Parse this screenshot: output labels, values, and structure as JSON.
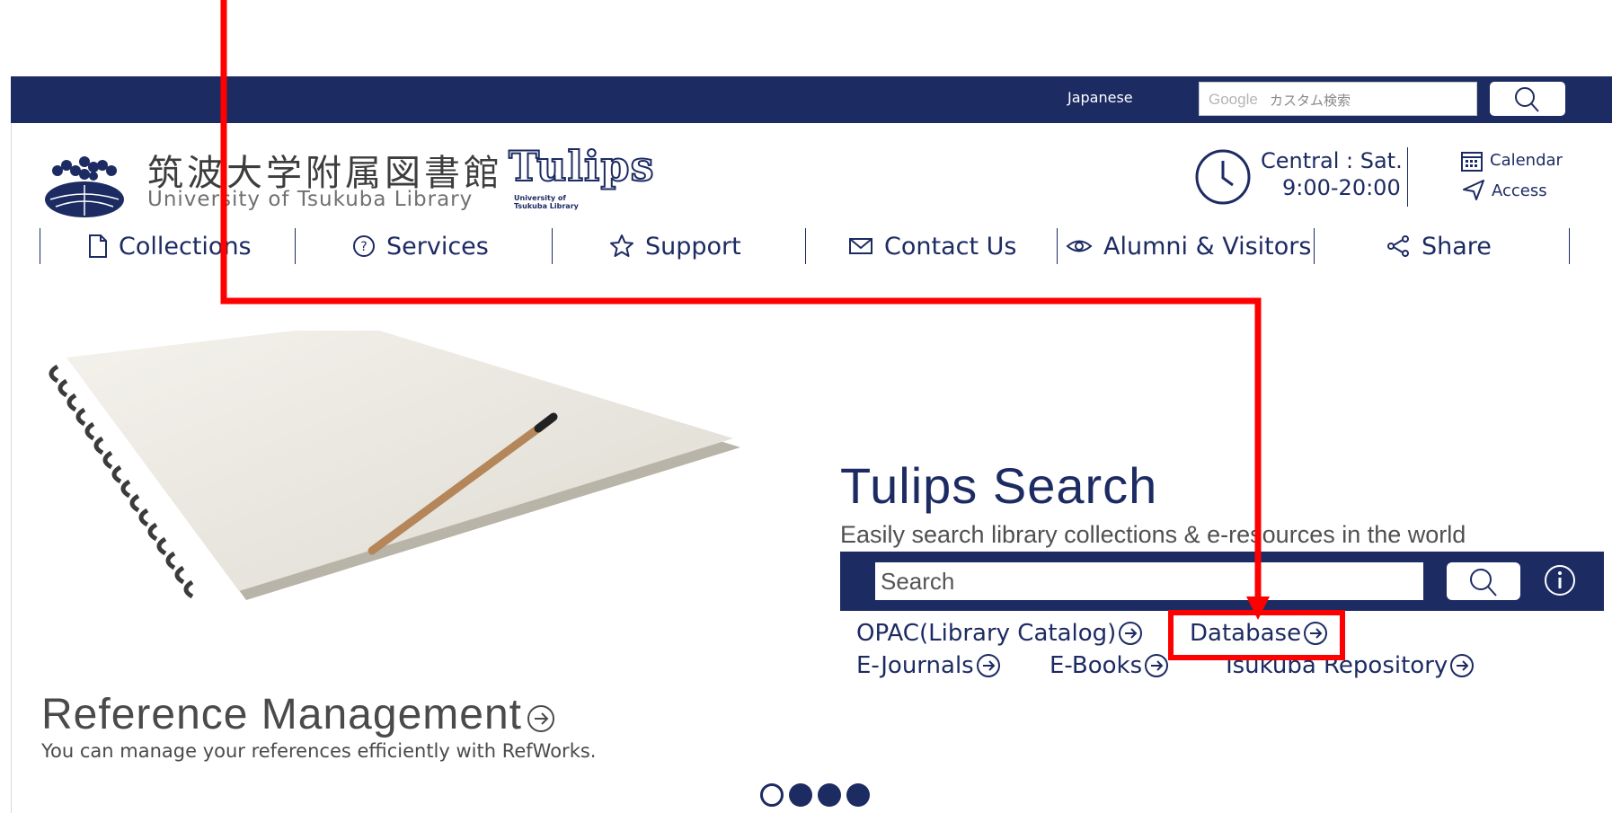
{
  "topbar": {
    "language_label": "Japanese",
    "google_label": "Google",
    "search_placeholder": "カスタム検索"
  },
  "header": {
    "logo_jp": "筑波大学附属図書館",
    "logo_en": "University of Tsukuba Library",
    "tulips_logo": "Tulips",
    "tulips_sub_1": "University of",
    "tulips_sub_2": "Tsukuba Library",
    "hours_line1": "Central : Sat.",
    "hours_line2": "9:00-20:00",
    "calendar_label": "Calendar",
    "access_label": "Access"
  },
  "nav": {
    "items": [
      {
        "label": "Collections",
        "icon": "document-icon"
      },
      {
        "label": "Services",
        "icon": "help-circle-icon"
      },
      {
        "label": "Support",
        "icon": "star-icon"
      },
      {
        "label": "Contact Us",
        "icon": "mail-icon"
      },
      {
        "label": "Alumni & Visitors",
        "icon": "eye-icon"
      },
      {
        "label": "Share",
        "icon": "share-icon"
      }
    ]
  },
  "search": {
    "title": "Tulips Search",
    "subtitle": "Easily search library collections & e-resources in the world",
    "placeholder": "Search",
    "links": {
      "opac": "OPAC(Library Catalog)",
      "database": "Database",
      "ejournals": "E-Journals",
      "ebooks": "E-Books",
      "repository": "Tsukuba Repository"
    }
  },
  "promo": {
    "title": "Reference Management",
    "subtitle": "You can manage your references efficiently with RefWorks."
  },
  "carousel": {
    "slide_count": 4,
    "active_index": 0
  },
  "colors": {
    "navy": "#1d2b63",
    "annotation_red": "#ff0000"
  }
}
